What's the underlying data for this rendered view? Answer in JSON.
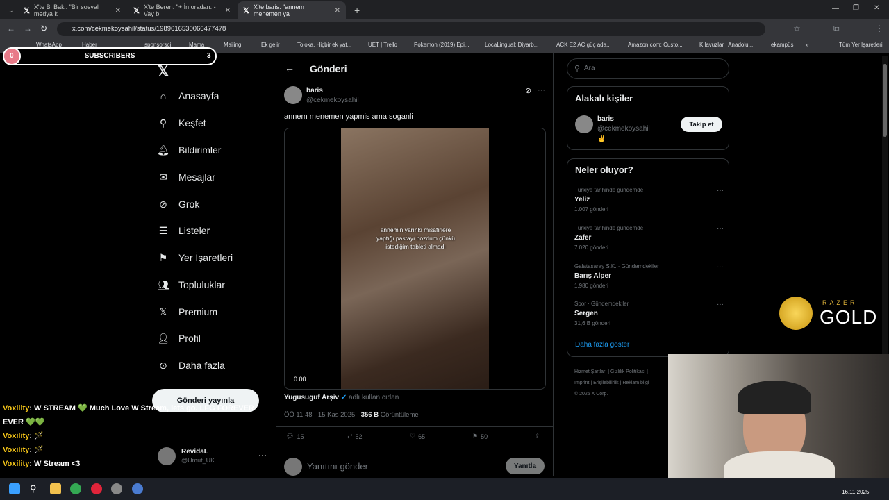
{
  "browser": {
    "tabs": [
      {
        "label": "X'te Bi Baki: \"Bir sosyal medya k"
      },
      {
        "label": "X'te Beren: \"+ İn oradan. - Vay b"
      },
      {
        "label": "X'te baris: \"annem menemen ya"
      }
    ],
    "url": "x.com/cekmekoysahil/status/1989616530066477478",
    "bookmarks": [
      "WhatsApp",
      "Haber",
      "sponsorsci",
      "Mama",
      "Mailing",
      "Ek gelir",
      "Toloka. Hiçbir ek yat...",
      "UET | Trello",
      "Pokemon (2019) Epi...",
      "LocaLingual: Diyarb...",
      "ACK E2 AC güç ada...",
      "Amazon.com: Custo...",
      "Kılavuzlar | Anadolu...",
      "ekampüs",
      "Tüm Yer İşaretleri"
    ]
  },
  "nav": {
    "items": [
      "Anasayfa",
      "Keşfet",
      "Bildirimler",
      "Mesajlar",
      "Grok",
      "Listeler",
      "Yer İşaretleri",
      "Topluluklar",
      "Premium",
      "Profil",
      "Daha fazla"
    ],
    "post_button": "Gönderi yayınla",
    "account_name": "RevidaL",
    "account_handle": "@Umut_UK"
  },
  "main": {
    "header_title": "Gönderi",
    "author_name": "baris",
    "author_handle": "@cekmekoysahil",
    "post_text": "annem menemen yapmis ama soganli",
    "video_caption": "annemin yarınki misafirlere yaptığı pastayı bozdum çünkü istediğim tableti almadı",
    "video_time": "0:00",
    "source_name": "Yugusuguf Arşiv",
    "source_suffix": "adlı kullanıcıdan",
    "timestamp": "ÖÖ 11:48 · 15 Kas 2025 ·",
    "views": "356 B",
    "views_label": "Görüntüleme",
    "replies": "15",
    "reposts": "52",
    "likes": "65",
    "bookmarks": "50",
    "reply_placeholder": "Yanıtını gönder",
    "reply_button": "Yanıtla"
  },
  "right": {
    "search_placeholder": "Ara",
    "related_title": "Alakalı kişiler",
    "related_name": "baris",
    "related_handle": "@cekmekoysahil",
    "related_emoji": "✌️",
    "follow_button": "Takip et",
    "trends_title": "Neler oluyor?",
    "trends": [
      {
        "context": "Türkiye tarihinde gündemde",
        "name": "Yeliz",
        "count": "1.007 gönderi"
      },
      {
        "context": "Türkiye tarihinde gündemde",
        "name": "Zafer",
        "count": "7.020 gönderi"
      },
      {
        "context": "Galatasaray S.K. · Gündemdekiler",
        "name": "Barış Alper",
        "count": "1.980 gönderi"
      },
      {
        "context": "Spor · Gündemdekiler",
        "name": "Sergen",
        "count": "31,6 B gönderi"
      }
    ],
    "show_more": "Daha fazla göster",
    "footer_line1": "Hizmet Şartları  |  Gizlilik Politikası  |",
    "footer_line2": "Imprint  |  Erişilebilirlik  |  Reklam bilgi",
    "footer_line3": "© 2025 X Corp."
  },
  "overlay": {
    "subs_left": "0",
    "subs_label": "SUBSCRIBERS",
    "subs_right": "3",
    "chat": [
      {
        "user": "Voxility",
        "msg": ": W STREAM 💚 Much Love W Stream, lets go. LFG FOREVER EVER 💚💚"
      },
      {
        "user": "Voxility",
        "msg": ": 🪄"
      },
      {
        "user": "Voxility",
        "msg": ": 🪄"
      },
      {
        "user": "Voxility",
        "msg": ": W Stream <3"
      }
    ],
    "razer_top": "RAZER",
    "razer_bottom": "GOLD"
  },
  "taskbar": {
    "date": "16.11.2025"
  }
}
